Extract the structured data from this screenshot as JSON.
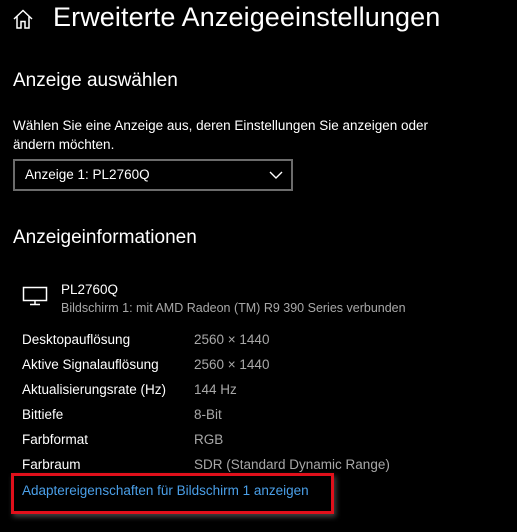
{
  "header": {
    "title": "Erweiterte Anzeigeeinstellungen",
    "home_icon": "home-icon"
  },
  "select_display": {
    "heading": "Anzeige auswählen",
    "description": "Wählen Sie eine Anzeige aus, deren Einstellungen Sie anzeigen oder ändern möchten.",
    "dropdown_value": "Anzeige 1: PL2760Q",
    "dropdown_icon": "chevron-down-icon"
  },
  "display_info": {
    "heading": "Anzeigeinformationen",
    "monitor_icon": "monitor-icon",
    "monitor_name": "PL2760Q",
    "monitor_connection": "Bildschirm 1: mit AMD Radeon (TM) R9 390 Series verbunden",
    "rows": [
      {
        "label": "Desktopauflösung",
        "value": "2560 × 1440"
      },
      {
        "label": "Aktive Signalauflösung",
        "value": "2560 × 1440"
      },
      {
        "label": "Aktualisierungsrate (Hz)",
        "value": "144 Hz"
      },
      {
        "label": "Bittiefe",
        "value": "8-Bit"
      },
      {
        "label": "Farbformat",
        "value": "RGB"
      },
      {
        "label": "Farbraum",
        "value": "SDR (Standard Dynamic Range)"
      }
    ],
    "adapter_link": "Adaptereigenschaften für Bildschirm 1 anzeigen"
  },
  "colors": {
    "background": "#000000",
    "text": "#ffffff",
    "secondary_text": "#a8a8a8",
    "link": "#4a9fe8",
    "dropdown_border": "#6b6b6b",
    "highlight": "#e0101b"
  }
}
